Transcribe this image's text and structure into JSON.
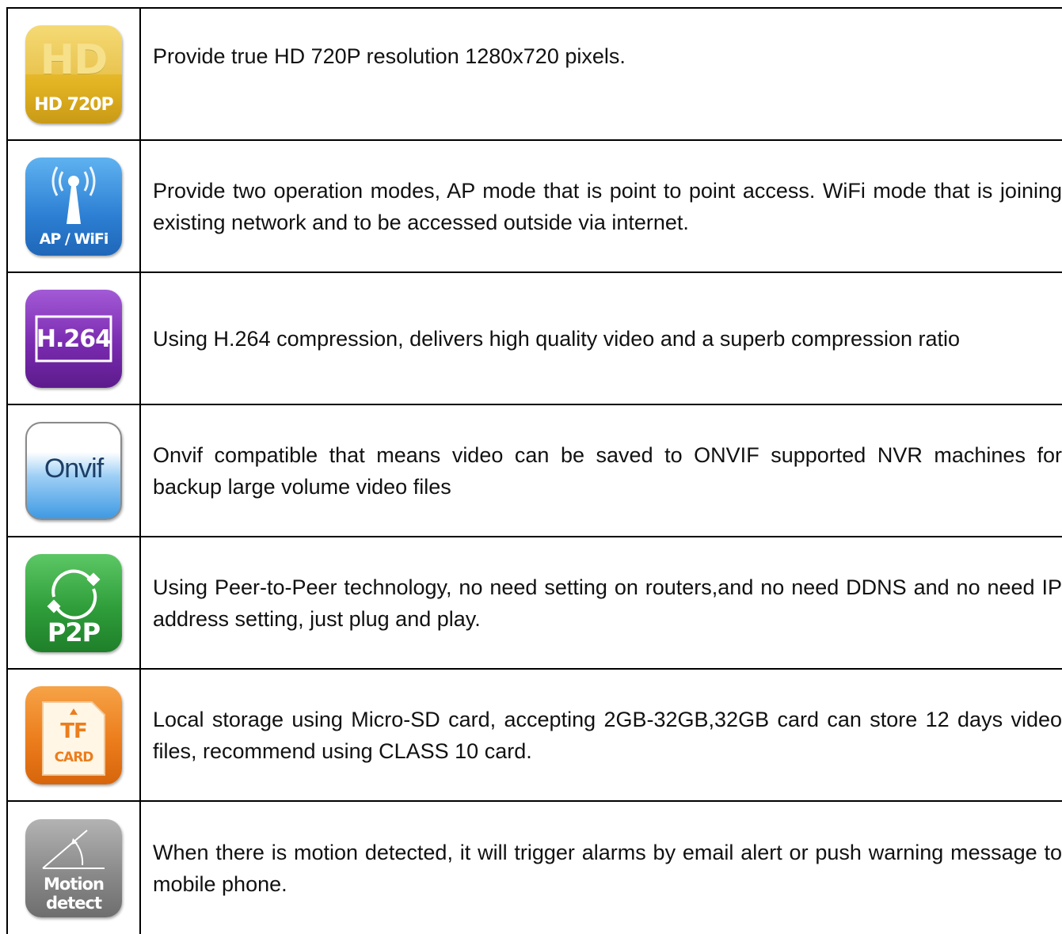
{
  "features": [
    {
      "icon": "hd-720p-icon",
      "icon_label": "HD 720P",
      "icon_big_text": "HD",
      "icon_color": "#e3b72a",
      "text": "Provide true HD 720P resolution 1280x720 pixels."
    },
    {
      "icon": "ap-wifi-icon",
      "icon_label": "AP / WiFi",
      "icon_color": "#2f86d8",
      "text": "Provide two operation modes, AP mode that is point to point access. WiFi mode that is joining existing network and to be accessed outside via internet."
    },
    {
      "icon": "h264-icon",
      "icon_label": "H.264",
      "icon_color": "#7a2bb0",
      "text": "Using H.264 compression, delivers high quality video and a superb compression ratio"
    },
    {
      "icon": "onvif-icon",
      "icon_label": "Onvif",
      "icon_color": "#4aa3e6",
      "text": "Onvif compatible that means video can be saved to ONVIF supported NVR machines for backup large volume video files"
    },
    {
      "icon": "p2p-icon",
      "icon_label": "P2P",
      "icon_color": "#2f9e3a",
      "text": "Using Peer-to-Peer technology, no need setting on routers,and no need DDNS and no need IP address setting, just plug and play."
    },
    {
      "icon": "tf-card-icon",
      "icon_label_top": "TF",
      "icon_label_bottom": "CARD",
      "icon_color": "#ec7d1c",
      "text": "Local storage using Micro-SD card, accepting 2GB-32GB,32GB card can store 12 days video files, recommend using CLASS 10 card."
    },
    {
      "icon": "motion-detect-icon",
      "icon_label_top": "Motion",
      "icon_label_bottom": "detect",
      "icon_color": "#8a8a8a",
      "text": "When there is motion detected, it will trigger alarms by email alert or push warning message to mobile phone."
    }
  ]
}
